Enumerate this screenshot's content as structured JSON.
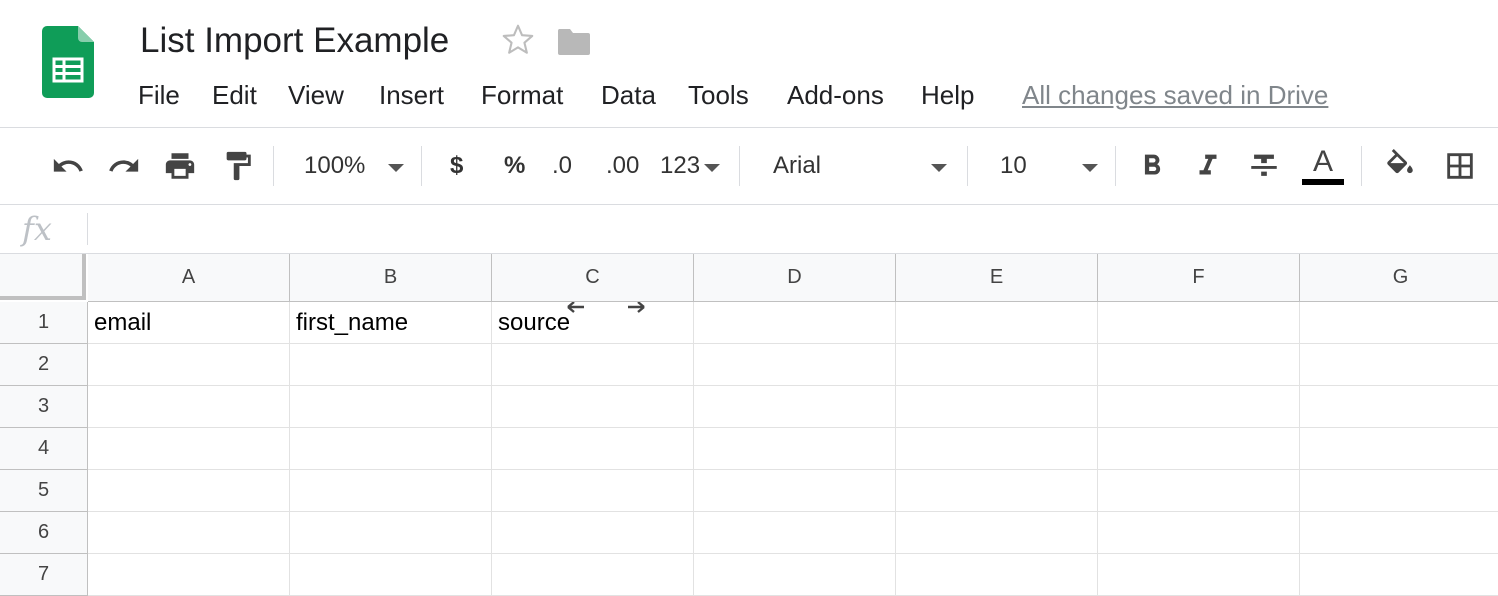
{
  "app": {
    "title": "List Import Example",
    "save_status": "All changes saved in Drive"
  },
  "icons": {
    "logo": "google-sheets-logo",
    "star": "star-outline-icon",
    "folder": "folder-icon"
  },
  "colors": {
    "sheets_green": "#0f9d58",
    "sheets_green_fold": "#87ceac",
    "text_color_bar": "#000000"
  },
  "menu": [
    {
      "id": "file",
      "label": "File"
    },
    {
      "id": "edit",
      "label": "Edit"
    },
    {
      "id": "view",
      "label": "View"
    },
    {
      "id": "insert",
      "label": "Insert"
    },
    {
      "id": "format",
      "label": "Format"
    },
    {
      "id": "data",
      "label": "Data"
    },
    {
      "id": "tools",
      "label": "Tools"
    },
    {
      "id": "addons",
      "label": "Add-ons"
    },
    {
      "id": "help",
      "label": "Help"
    }
  ],
  "toolbar": {
    "zoom": "100%",
    "currency": "$",
    "percent": "%",
    "decrease_decimal": ".0",
    "increase_decimal": ".00",
    "more_formats": "123",
    "font_family": "Arial",
    "font_size": "10",
    "text_color_label": "A"
  },
  "formula_bar": {
    "fx_label": "fx",
    "value": ""
  },
  "grid": {
    "columns": [
      "A",
      "B",
      "C",
      "D",
      "E",
      "F",
      "G"
    ],
    "rows": [
      "1",
      "2",
      "3",
      "4",
      "5",
      "6",
      "7"
    ],
    "cells": [
      [
        "email",
        "first_name",
        "source",
        "",
        "",
        "",
        ""
      ],
      [
        "",
        "",
        "",
        "",
        "",
        "",
        ""
      ],
      [
        "",
        "",
        "",
        "",
        "",
        "",
        ""
      ],
      [
        "",
        "",
        "",
        "",
        "",
        "",
        ""
      ],
      [
        "",
        "",
        "",
        "",
        "",
        "",
        ""
      ],
      [
        "",
        "",
        "",
        "",
        "",
        "",
        ""
      ],
      [
        "",
        "",
        "",
        "",
        "",
        "",
        ""
      ]
    ]
  }
}
